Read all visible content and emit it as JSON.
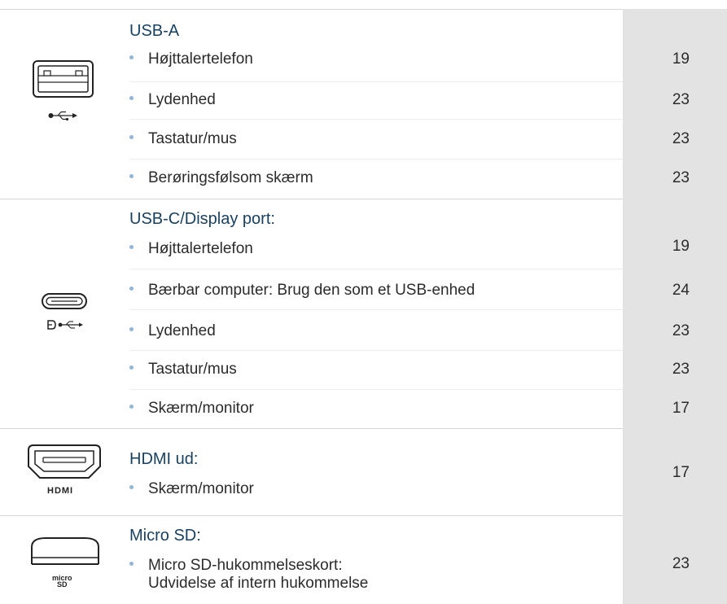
{
  "sections": [
    {
      "title": "USB-A",
      "items": [
        {
          "label": "Højttalertelefon",
          "page": "19"
        },
        {
          "label": "Lydenhed",
          "page": "23"
        },
        {
          "label": "Tastatur/mus",
          "page": "23"
        },
        {
          "label": "Berøringsfølsom skærm",
          "page": "23"
        }
      ]
    },
    {
      "title": "USB-C/Display port:",
      "items": [
        {
          "label": "Højttalertelefon",
          "page": "19"
        },
        {
          "label": "Bærbar computer: Brug den som et USB-enhed",
          "page": "24"
        },
        {
          "label": "Lydenhed",
          "page": "23"
        },
        {
          "label": "Tastatur/mus",
          "page": "23"
        },
        {
          "label": "Skærm/monitor",
          "page": "17"
        }
      ]
    },
    {
      "title": "HDMI ud:",
      "items": [
        {
          "label": "Skærm/monitor",
          "page": "17"
        }
      ]
    },
    {
      "title": "Micro SD:",
      "items": [
        {
          "label_line1": "Micro SD-hukommelseskort:",
          "label_line2": "Udvidelse af intern hukommelse",
          "page": "23"
        }
      ]
    }
  ],
  "icons": {
    "usb_a_port": "usb-a-port-icon",
    "usb_symbol": "usb-symbol-icon",
    "usb_c_port": "usb-c-port-icon",
    "displayport_usb_symbol": "displayport-usb-symbol-icon",
    "hdmi_port": "hdmi-port-icon",
    "hdmi_logo": "HDMI",
    "microsd_slot": "microsd-slot-icon",
    "microsd_logo_line1": "micro",
    "microsd_logo_line2": "SD"
  },
  "colors": {
    "title": "#173f5f",
    "bullet": "#8fb6d6",
    "page_column": "#e3e3e3",
    "text": "#2b2b2b"
  }
}
